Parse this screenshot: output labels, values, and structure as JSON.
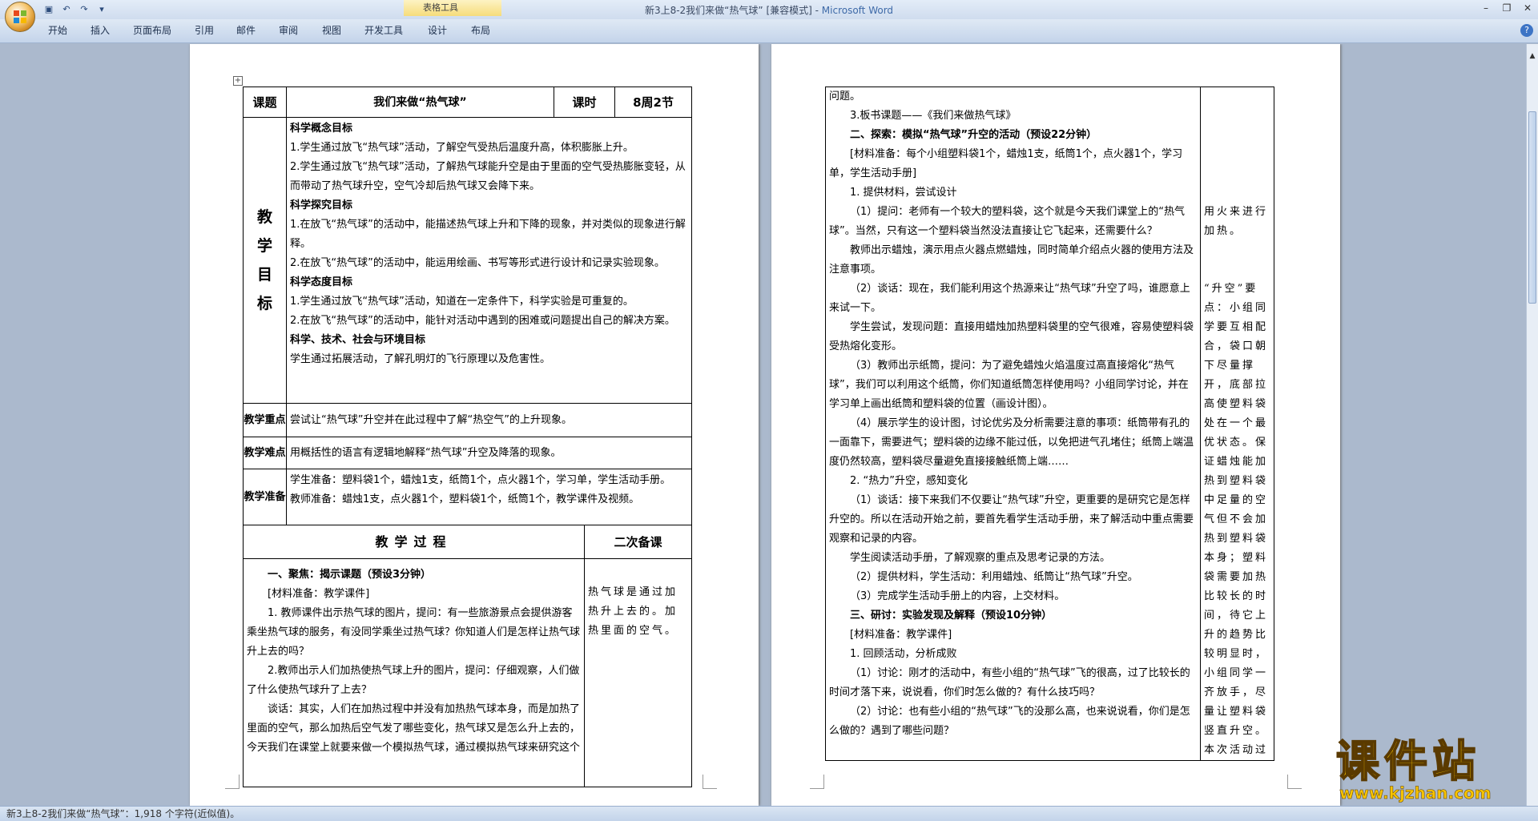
{
  "window": {
    "doc_name": "新3上8-2我们来做“热气球”",
    "mode": "[兼容模式]",
    "app_name": "Microsoft Word",
    "separator": " - ",
    "context_tab_group": "表格工具"
  },
  "ribbon": {
    "tabs": [
      "开始",
      "插入",
      "页面布局",
      "引用",
      "邮件",
      "审阅",
      "视图",
      "开发工具",
      "设计",
      "布局"
    ]
  },
  "left_page": {
    "header": {
      "topic_label": "课题",
      "topic_value": "我们来做“热气球”",
      "hours_label": "课时",
      "hours_value": "8周2节"
    },
    "goals_label": [
      "教",
      "学",
      "目",
      "标"
    ],
    "goals": [
      {
        "h": "科学概念目标",
        "items": [
          "1.学生通过放飞“热气球”活动，了解空气受热后温度升高，体积膨胀上升。",
          "2.学生通过放飞“热气球”活动，了解热气球能升空是由于里面的空气受热膨胀变轻，从而带动了热气球升空，空气冷却后热气球又会降下来。"
        ]
      },
      {
        "h": "科学探究目标",
        "items": [
          "1.在放飞“热气球”的活动中，能描述热气球上升和下降的现象，并对类似的现象进行解释。",
          "2.在放飞“热气球”的活动中，能运用绘画、书写等形式进行设计和记录实验现象。"
        ]
      },
      {
        "h": "科学态度目标",
        "items": [
          "1.学生通过放飞“热气球”活动，知道在一定条件下，科学实验是可重复的。",
          "2.在放飞“热气球”的活动中，能针对活动中遇到的困难或问题提出自己的解决方案。"
        ]
      },
      {
        "h": "科学、技术、社会与环境目标",
        "items": [
          "学生通过拓展活动，了解孔明灯的飞行原理以及危害性。"
        ]
      }
    ],
    "key_label": "教学重点",
    "key_text": "尝试让“热气球”升空并在此过程中了解“热空气”的上升现象。",
    "diff_label": "教学难点",
    "diff_text": "用概括性的语言有逻辑地解释“热气球”升空及降落的现象。",
    "prep_label": "教学准备",
    "prep_student": "学生准备：塑料袋1个，蜡烛1支，纸筒1个，点火器1个，学习单，学生活动手册。",
    "prep_teacher": "教师准备：蜡烛1支，点火器1个，塑料袋1个，纸筒1个，教学课件及视频。",
    "process_label": "教学过程",
    "note_label": "二次备课",
    "process": [
      {
        "t": "一、聚焦：揭示课题（预设3分钟）",
        "bold": true
      },
      {
        "t": "[材料准备：教学课件]",
        "bold": false
      },
      {
        "t": "1. 教师课件出示热气球的图片，提问：有一些旅游景点会提供游客乘坐热气球的服务，有没同学乘坐过热气球？你知道人们是怎样让热气球升上去的吗？",
        "bold": false
      },
      {
        "t": "2.教师出示人们加热使热气球上升的图片，提问：仔细观察，人们做了什么使热气球升了上去？",
        "bold": false
      },
      {
        "t": "谈话：其实，人们在加热过程中并没有加热热气球本身，而是加热了里面的空气，那么加热后空气发了哪些变化，热气球又是怎么升上去的，今天我们在课堂上就要来做一个模拟热气球，通过模拟热气球来研究这个",
        "bold": false
      }
    ],
    "note": "热气球是通过加热升上去的。加热里面的空气。"
  },
  "right_page": {
    "process": [
      {
        "t": "问题。",
        "bold": false,
        "indent": false
      },
      {
        "t": "3.板书课题——《我们来做热气球》",
        "bold": false,
        "indent": true
      },
      {
        "t": "二、探索：模拟“热气球”升空的活动（预设22分钟）",
        "bold": true,
        "indent": true
      },
      {
        "t": "[材料准备：每个小组塑料袋1个，蜡烛1支，纸筒1个，点火器1个，学习单，学生活动手册]",
        "bold": false,
        "indent": true
      },
      {
        "t": "1. 提供材料，尝试设计",
        "bold": false,
        "indent": true
      },
      {
        "t": "（1）提问：老师有一个较大的塑料袋，这个就是今天我们课堂上的“热气球”。当然，只有这一个塑料袋当然没法直接让它飞起来，还需要什么？",
        "bold": false,
        "indent": true
      },
      {
        "t": "教师出示蜡烛，演示用点火器点燃蜡烛，同时简单介绍点火器的使用方法及注意事项。",
        "bold": false,
        "indent": true
      },
      {
        "t": "（2）谈话：现在，我们能利用这个热源来让“热气球”升空了吗，谁愿意上来试一下。",
        "bold": false,
        "indent": true
      },
      {
        "t": "学生尝试，发现问题：直接用蜡烛加热塑料袋里的空气很难，容易使塑料袋受热熔化变形。",
        "bold": false,
        "indent": true
      },
      {
        "t": "（3）教师出示纸筒，提问：为了避免蜡烛火焰温度过高直接熔化“热气球”，我们可以利用这个纸筒，你们知道纸筒怎样使用吗？小组同学讨论，并在学习单上画出纸筒和塑料袋的位置（画设计图）。",
        "bold": false,
        "indent": true
      },
      {
        "t": "（4）展示学生的设计图，讨论优劣及分析需要注意的事项：纸筒带有孔的一面靠下，需要进气；塑料袋的边缘不能过低，以免把进气孔堵住；纸筒上端温度仍然较高，塑料袋尽量避免直接接触纸筒上端……",
        "bold": false,
        "indent": true
      },
      {
        "t": "2. “热力”升空，感知变化",
        "bold": false,
        "indent": true
      },
      {
        "t": "（1）谈话：接下来我们不仅要让“热气球”升空，更重要的是研究它是怎样升空的。所以在活动开始之前，要首先看学生活动手册，来了解活动中重点需要观察和记录的内容。",
        "bold": false,
        "indent": true
      },
      {
        "t": "学生阅读活动手册，了解观察的重点及思考记录的方法。",
        "bold": false,
        "indent": true
      },
      {
        "t": "（2）提供材料，学生活动：利用蜡烛、纸筒让“热气球”升空。",
        "bold": false,
        "indent": true
      },
      {
        "t": "（3）完成学生活动手册上的内容，上交材料。",
        "bold": false,
        "indent": true
      },
      {
        "t": "三、研讨：实验发现及解释（预设10分钟）",
        "bold": true,
        "indent": true
      },
      {
        "t": "[材料准备：教学课件]",
        "bold": false,
        "indent": true
      },
      {
        "t": "1. 回顾活动，分析成败",
        "bold": false,
        "indent": true
      },
      {
        "t": "（1）讨论：刚才的活动中，有些小组的“热气球”飞的很高，过了比较长的时间才落下来，说说看，你们时怎么做的？有什么技巧吗？",
        "bold": false,
        "indent": true
      },
      {
        "t": "（2）讨论：也有些小组的“热气球”飞的没那么高，也来说说看，你们是怎么做的？遇到了哪些问题？",
        "bold": false,
        "indent": true
      }
    ],
    "note_1": "用火来进行加热。",
    "note_2": "“升空”要点：小组同学要互相配合，袋口朝下尽量撑开，底部拉高使塑料袋处在一个最优状态。保证蜡烛能加热到塑料袋中足量的空气但不会加热到塑料袋本身；塑料袋需要加热比较长的时间，待它上升的趋势比较明显时，小组同学一齐放手，尽量让塑料袋竖直升空。本次活动过"
  },
  "status": {
    "text": "新3上8-2我们来做“热气球”：1,918 个字符(近似值)。"
  },
  "watermark": {
    "big": "课件站",
    "url": "www.kjzhan.com"
  },
  "colors": {
    "ribbon_bg": "#cfdcee",
    "workspace": "#abb9cd",
    "context_tab": "#f6dc7a",
    "app_title": "#3e6aa8",
    "watermark": "#f7c400"
  }
}
